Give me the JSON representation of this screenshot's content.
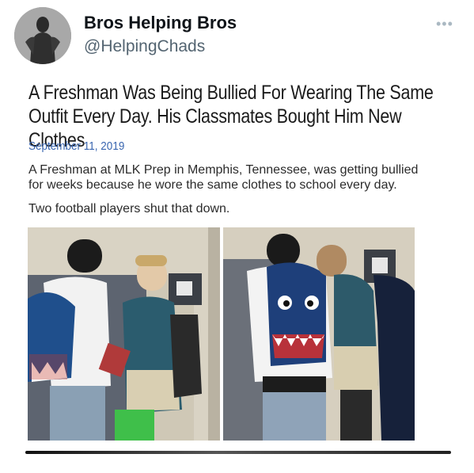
{
  "tweet": {
    "display_name": "Bros Helping Bros",
    "handle": "@HelpingChads",
    "more_icon": "more-horizontal-icon"
  },
  "article": {
    "headline": "A Freshman Was Being Bullied For Wearing The Same Outfit Every Day. His Classmates Bought Him New Clothes",
    "date": "September 11, 2019",
    "paragraphs": [
      "A Freshman at MLK Prep in Memphis, Tennessee, was getting bullied for weeks because he wore the same clothes to school every day.",
      "Two football players shut that down."
    ]
  },
  "colors": {
    "name": "#0f1419",
    "handle": "#536471",
    "date": "#3a66b0"
  }
}
